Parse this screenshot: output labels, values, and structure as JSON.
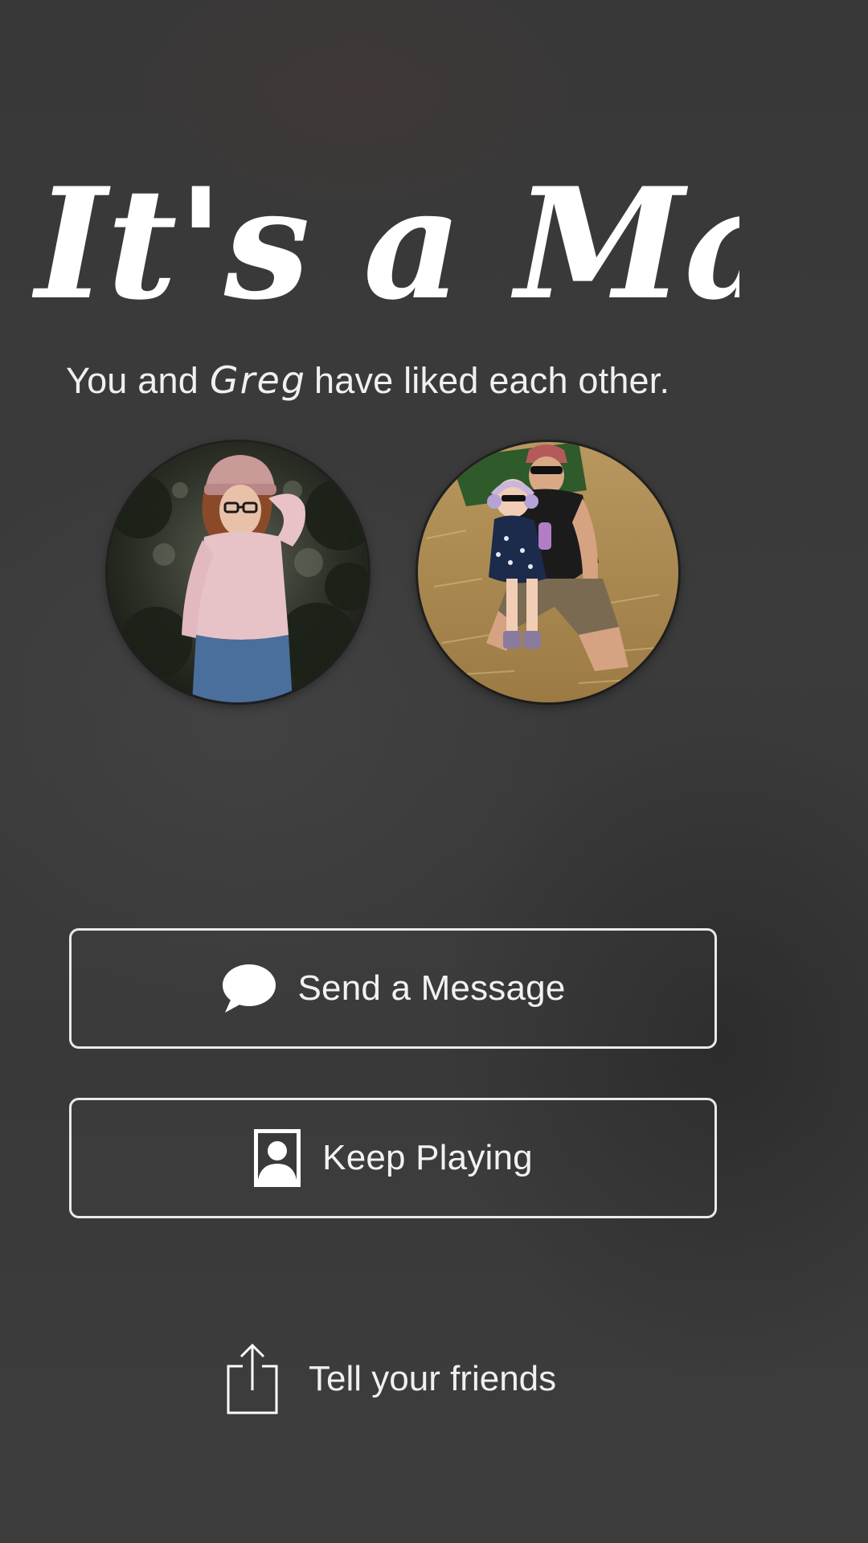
{
  "match_screen": {
    "title": "It's a Match!",
    "subtitle_prefix": "You and",
    "match_name": "Greg",
    "subtitle_suffix": "have liked each other."
  },
  "avatars": {
    "user_photo_icon": "profile-photo-woman",
    "match_photo_icon": "profile-photo-man-and-child"
  },
  "actions": {
    "send_message_label": "Send a Message",
    "send_message_icon": "speech-bubble-icon",
    "keep_playing_label": "Keep Playing",
    "keep_playing_icon": "person-card-icon",
    "share_label": "Tell your friends",
    "share_icon": "share-icon"
  },
  "colors": {
    "background": "#3a3a3a",
    "text": "#ffffff",
    "button_border": "#eaeaea"
  }
}
